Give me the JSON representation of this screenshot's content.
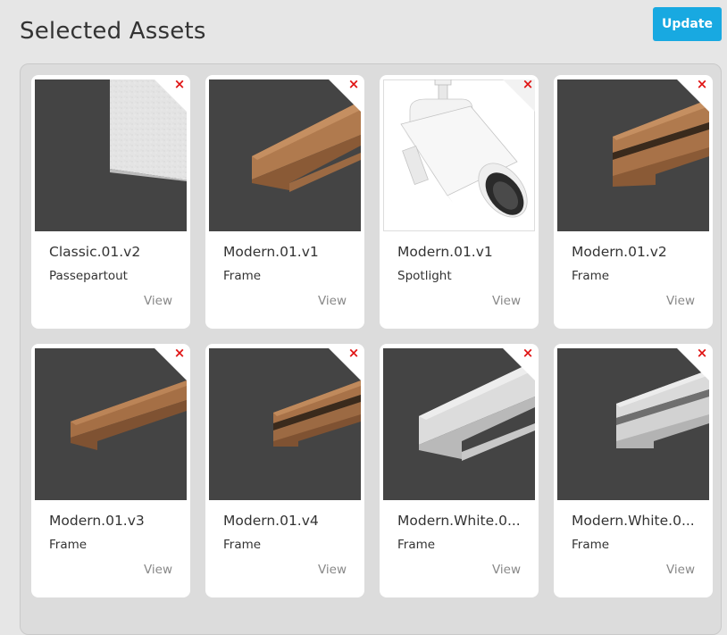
{
  "page": {
    "title": "Selected Assets"
  },
  "toolbar": {
    "update_label": "Update"
  },
  "colors": {
    "accent": "#18a9e1",
    "remove": "#e01515",
    "thumb_bg": "#444444"
  },
  "assets": [
    {
      "name": "Classic.01.v2",
      "type": "Passepartout",
      "view_label": "View",
      "remove_icon": "×",
      "thumb": "passepartout"
    },
    {
      "name": "Modern.01.v1",
      "type": "Frame",
      "view_label": "View",
      "remove_icon": "×",
      "thumb": "frame-wood"
    },
    {
      "name": "Modern.01.v1",
      "type": "Spotlight",
      "view_label": "View",
      "remove_icon": "×",
      "thumb": "spotlight"
    },
    {
      "name": "Modern.01.v2",
      "type": "Frame",
      "view_label": "View",
      "remove_icon": "×",
      "thumb": "frame-wood-groove"
    },
    {
      "name": "Modern.01.v3",
      "type": "Frame",
      "view_label": "View",
      "remove_icon": "×",
      "thumb": "frame-wood-thin"
    },
    {
      "name": "Modern.01.v4",
      "type": "Frame",
      "view_label": "View",
      "remove_icon": "×",
      "thumb": "frame-wood-double"
    },
    {
      "name": "Modern.White.0...",
      "type": "Frame",
      "view_label": "View",
      "remove_icon": "×",
      "thumb": "frame-white"
    },
    {
      "name": "Modern.White.0...",
      "type": "Frame",
      "view_label": "View",
      "remove_icon": "×",
      "thumb": "frame-white-groove"
    }
  ]
}
